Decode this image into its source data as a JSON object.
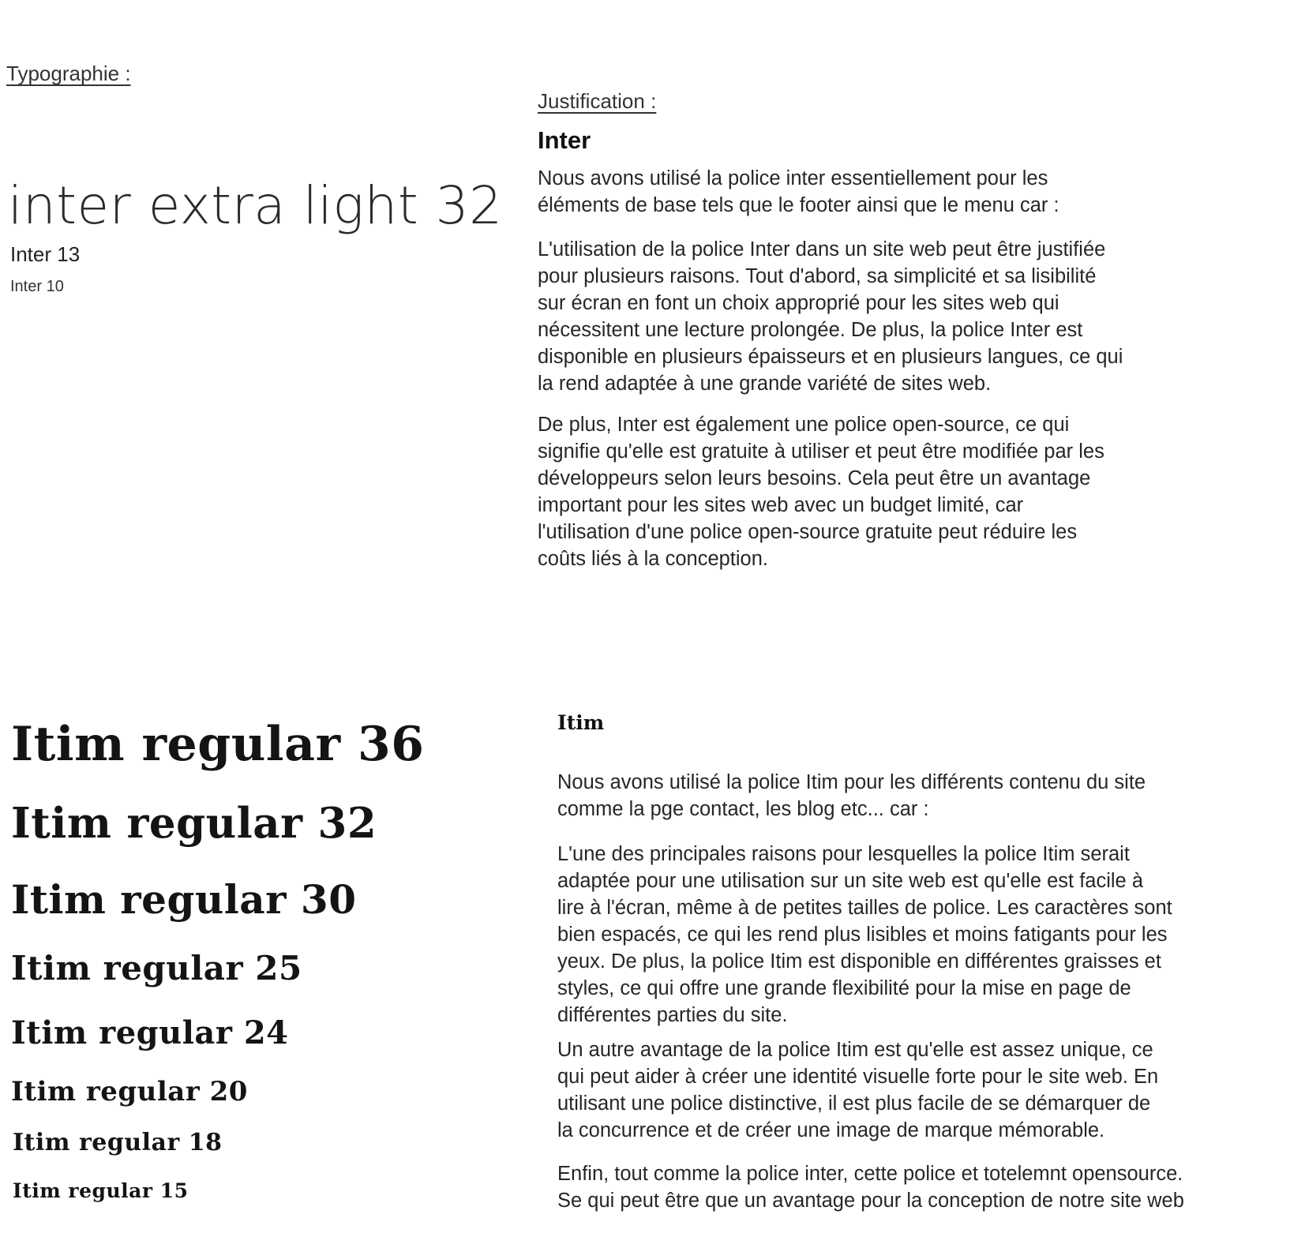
{
  "left": {
    "typography_label": "Typographie :",
    "inter_samples": {
      "extra_light_32": "inter extra light 32",
      "inter_13": "Inter 13",
      "inter_10": "Inter 10"
    },
    "itim_samples": {
      "s36": "Itim regular 36",
      "s32": "Itim regular 32",
      "s30": "Itim regular 30",
      "s25": "Itim regular 25",
      "s24": "Itim regular 24",
      "s20": "Itim regular 20",
      "s18": "Itim regular 18",
      "s15": "Itim regular 15"
    }
  },
  "right": {
    "justification_label": "Justification :",
    "inter_section": {
      "heading": "Inter",
      "p1": "Nous avons utilisé la police inter essentiellement pour les\néléments de base tels que le footer ainsi que le menu car :",
      "p2": "L'utilisation de la police Inter dans un site web peut être justifiée\npour plusieurs raisons. Tout d'abord, sa simplicité et sa lisibilité\nsur écran en font un choix approprié pour les sites web qui\nnécessitent une lecture prolongée. De plus, la police Inter est\ndisponible en plusieurs épaisseurs et en plusieurs langues, ce qui\nla rend adaptée à une grande variété de sites web.",
      "p3": "De plus, Inter est également une police open-source, ce qui\nsignifie qu'elle est gratuite à utiliser et peut être modifiée par les\ndéveloppeurs selon leurs besoins. Cela peut être un avantage\nimportant pour les sites web avec un budget limité, car\nl'utilisation d'une police open-source gratuite peut réduire les\ncoûts liés à la conception."
    },
    "itim_section": {
      "heading": "Itim",
      "p1": "Nous avons utilisé la police Itim pour les différents contenu du site\ncomme la pge contact, les blog etc... car :",
      "p2": "L'une des principales raisons pour lesquelles la police Itim serait\nadaptée pour une utilisation sur un site web est qu'elle est facile à\nlire à l'écran, même à de petites tailles de police. Les caractères sont\nbien espacés, ce qui les rend plus lisibles et moins fatigants pour les\nyeux. De plus, la police Itim est disponible en différentes graisses et\nstyles, ce qui offre une grande flexibilité pour la mise en page de\ndifférentes parties du site.",
      "p3": "Un autre avantage de la police Itim est qu'elle est assez unique, ce\nqui peut aider à créer une identité visuelle forte pour le site web. En\nutilisant une police distinctive, il est plus facile de se démarquer de\nla concurrence et de créer une image de marque mémorable.",
      "p4": "Enfin, tout comme la police inter, cette police et totelemnt opensource.\nSe qui peut être que un avantage pour la conception de notre site web"
    }
  }
}
